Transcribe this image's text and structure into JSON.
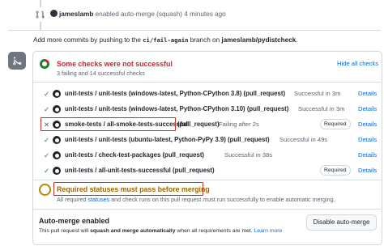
{
  "event": {
    "user": "jameslamb",
    "text": "enabled auto-merge (squash) 4 minutes ago"
  },
  "hint": {
    "prefix": "Add more commits by pushing to the",
    "branch": "ci/fail-again",
    "middle": "branch on",
    "repo": "jameslamb/pydistcheck",
    "suffix": "."
  },
  "checks": {
    "title": "Some checks were not successful",
    "summary": "3 failing and 14 successful checks",
    "hide_label": "Hide all checks",
    "details_label": "Details",
    "required_label": "Required",
    "rows": [
      {
        "status": "success",
        "name": "unit-tests / unit-tests (windows-latest, Python-CPython 3.8) (pull_request)",
        "detail": "Successful in 3m",
        "required": false
      },
      {
        "status": "success",
        "name": "unit-tests / unit-tests (windows-latest, Python-CPython 3.10) (pull_request)",
        "detail": "Successful in 3m",
        "required": false
      },
      {
        "status": "failure",
        "name": "smoke-tests / all-smoke-tests-successful",
        "name_suffix": "(pull_request)",
        "detail": "Failing after 2s",
        "required": true
      },
      {
        "status": "success",
        "name": "unit-tests / unit-tests (ubuntu-latest, Python-PyPy 3.9) (pull_request)",
        "detail": "Successful in 49s",
        "required": false
      },
      {
        "status": "success",
        "name": "unit-tests / check-test-packages (pull_request)",
        "detail": "Successful in 38s",
        "required": false
      },
      {
        "status": "success",
        "name": "unit-tests / all-unit-tests-successful (pull_request)",
        "detail": "",
        "required": true
      }
    ]
  },
  "required_statuses": {
    "title": "Required statuses must pass before merging",
    "sub_prefix": "All required",
    "sub_link": "statuses",
    "sub_suffix": "and check runs on this pull request must run successfully to enable automatic merging."
  },
  "auto_merge": {
    "title": "Auto-merge enabled",
    "sub_prefix": "This pull request will",
    "sub_bold": "squash and merge automatically",
    "sub_suffix": "when all requirements are met.",
    "learn_more": "Learn more",
    "disable_label": "Disable auto-merge"
  },
  "colors": {
    "failure": "#cf222e",
    "success": "#1a7f37",
    "pending": "#bf8700",
    "link": "#0969da",
    "highlight": "#c8321e"
  }
}
